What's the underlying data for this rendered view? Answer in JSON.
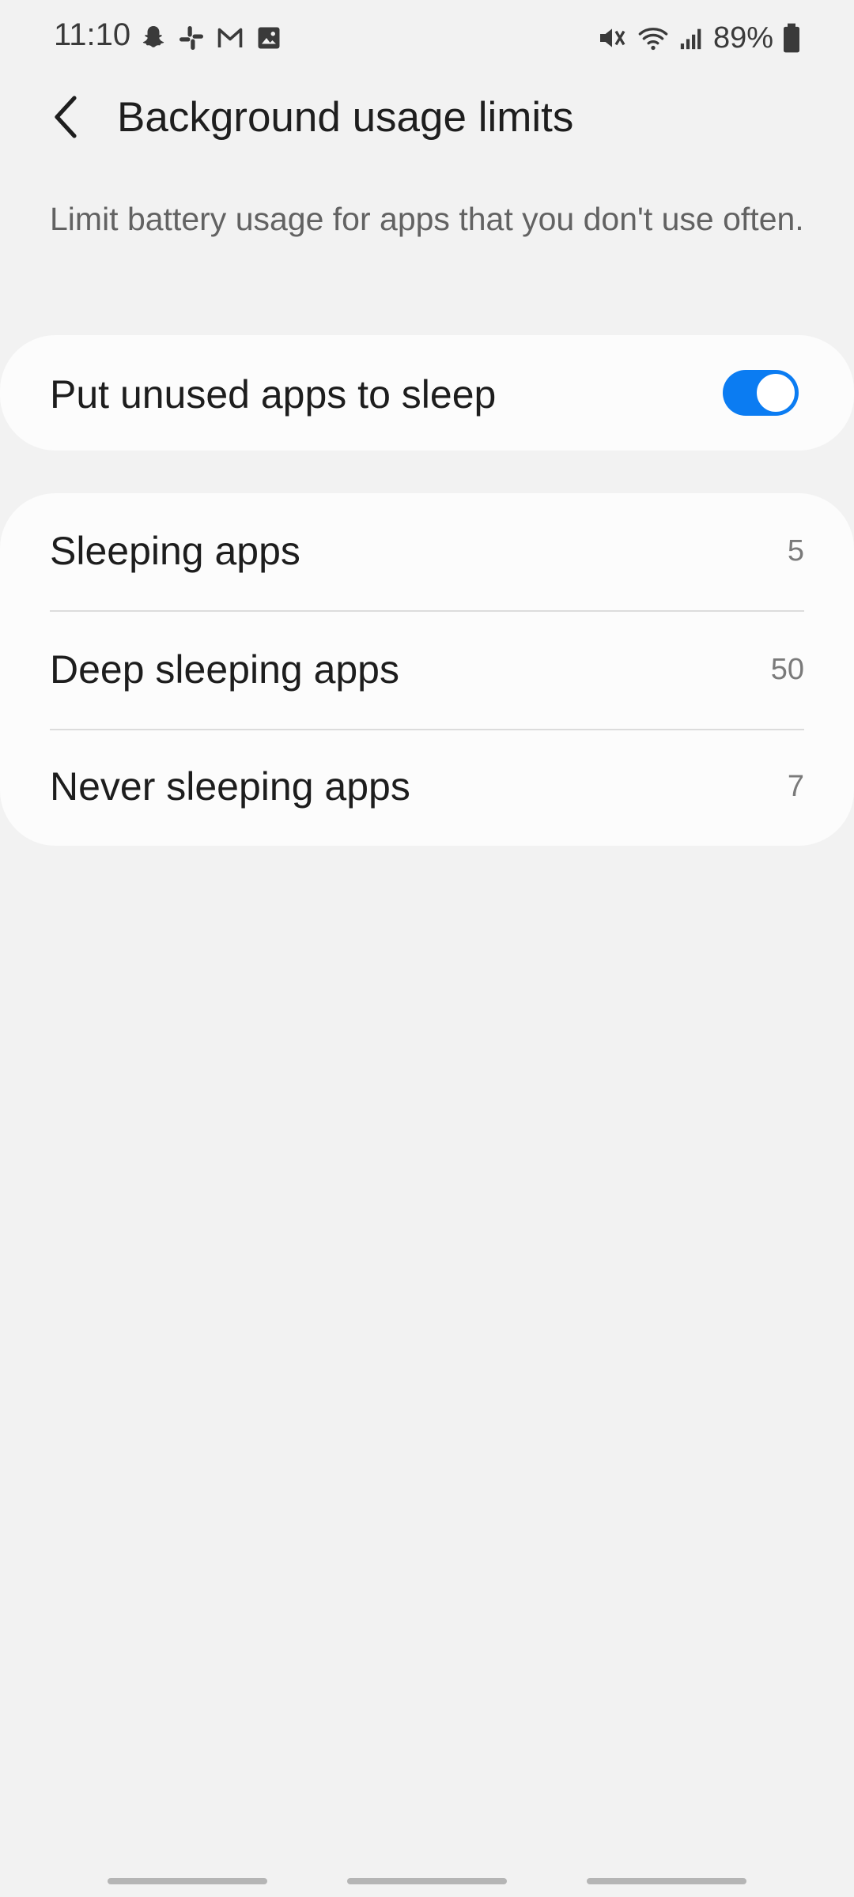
{
  "status_bar": {
    "time": "11:10",
    "left_icons": [
      "snapchat-icon",
      "slack-icon",
      "gmail-icon",
      "gallery-icon"
    ],
    "right_icons": [
      "vibrate-mute-icon",
      "wifi-icon",
      "cell-signal-icon",
      "battery-icon"
    ],
    "battery_percent": "89%"
  },
  "header": {
    "title": "Background usage limits",
    "back_icon": "chevron-left-icon"
  },
  "description": "Limit battery usage for apps that you don't use often.",
  "toggle_card": {
    "label": "Put unused apps to sleep",
    "enabled": true,
    "accent_color": "#0b7cf2"
  },
  "list": {
    "items": [
      {
        "label": "Sleeping apps",
        "count": "5"
      },
      {
        "label": "Deep sleeping apps",
        "count": "50"
      },
      {
        "label": "Never sleeping apps",
        "count": "7"
      }
    ]
  },
  "nav_bar": {
    "buttons": [
      "recents",
      "home",
      "back"
    ]
  }
}
